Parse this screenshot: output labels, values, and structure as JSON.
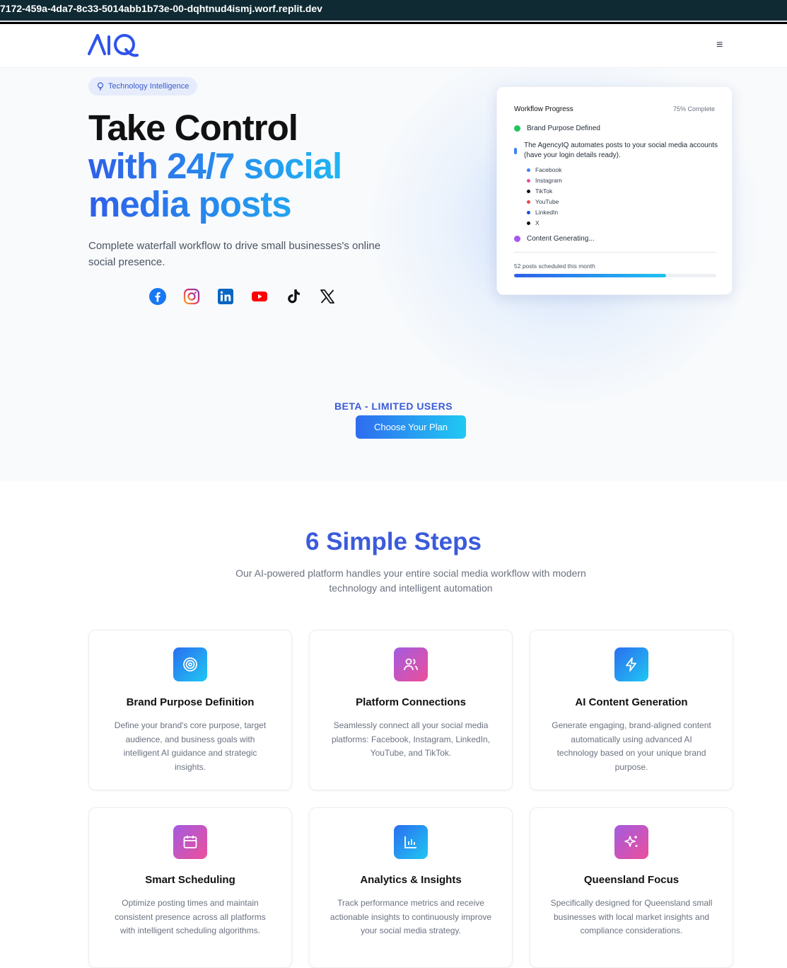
{
  "browser": {
    "url": "7172-459a-4da7-8c33-5014abb1b73e-00-dqhtnud4ismj.worf.replit.dev"
  },
  "nav": {
    "logo_text": "AIQ",
    "menu_glyph": "≡"
  },
  "hero": {
    "badge": "Technology Intelligence",
    "title_line1": "Take Control",
    "title_line2": "with 24/7 social",
    "title_line3": "media posts",
    "subtitle": "Complete waterfall workflow to drive small businesses's online social presence.",
    "social_icons": [
      "facebook-icon",
      "instagram-icon",
      "linkedin-icon",
      "youtube-icon",
      "tiktok-icon",
      "x-icon"
    ]
  },
  "workflow": {
    "title": "Workflow Progress",
    "percent_label": "75% Complete",
    "step1": "Brand Purpose Defined",
    "step2": "The AgencyIQ automates posts to your social media accounts (have your login details ready).",
    "platforms": [
      {
        "name": "Facebook",
        "color": "#3b82f6"
      },
      {
        "name": "Instagram",
        "color": "#ec4899"
      },
      {
        "name": "TikTok",
        "color": "#111111"
      },
      {
        "name": "YouTube",
        "color": "#ef4444"
      },
      {
        "name": "LinkedIn",
        "color": "#1d4ed8"
      },
      {
        "name": "X",
        "color": "#111111"
      }
    ],
    "step3": "Content Generating...",
    "scheduled_label": "52 posts scheduled this month",
    "progress_fraction": 0.75
  },
  "cta": {
    "beta_label": "BETA - LIMITED USERS",
    "button_label": "Choose Your Plan"
  },
  "steps_section": {
    "title": "6 Simple Steps",
    "subtitle": "Our AI-powered platform handles your entire social media workflow with modern technology and intelligent automation",
    "cards": [
      {
        "icon": "target-icon",
        "title": "Brand Purpose Definition",
        "desc": "Define your brand's core purpose, target audience, and business goals with intelligent AI guidance and strategic insights."
      },
      {
        "icon": "users-icon",
        "title": "Platform Connections",
        "desc": "Seamlessly connect all your social media platforms: Facebook, Instagram, LinkedIn, YouTube, and TikTok."
      },
      {
        "icon": "lightning-icon",
        "title": "AI Content Generation",
        "desc": "Generate engaging, brand-aligned content automatically using advanced AI technology based on your unique brand purpose."
      },
      {
        "icon": "calendar-icon",
        "title": "Smart Scheduling",
        "desc": "Optimize posting times and maintain consistent presence across all platforms with intelligent scheduling algorithms."
      },
      {
        "icon": "bar-chart-icon",
        "title": "Analytics & Insights",
        "desc": "Track performance metrics and receive actionable insights to continuously improve your social media strategy."
      },
      {
        "icon": "sparkles-icon",
        "title": "Queensland Focus",
        "desc": "Specifically designed for Queensland small businesses with local market insights and compliance considerations."
      }
    ]
  }
}
